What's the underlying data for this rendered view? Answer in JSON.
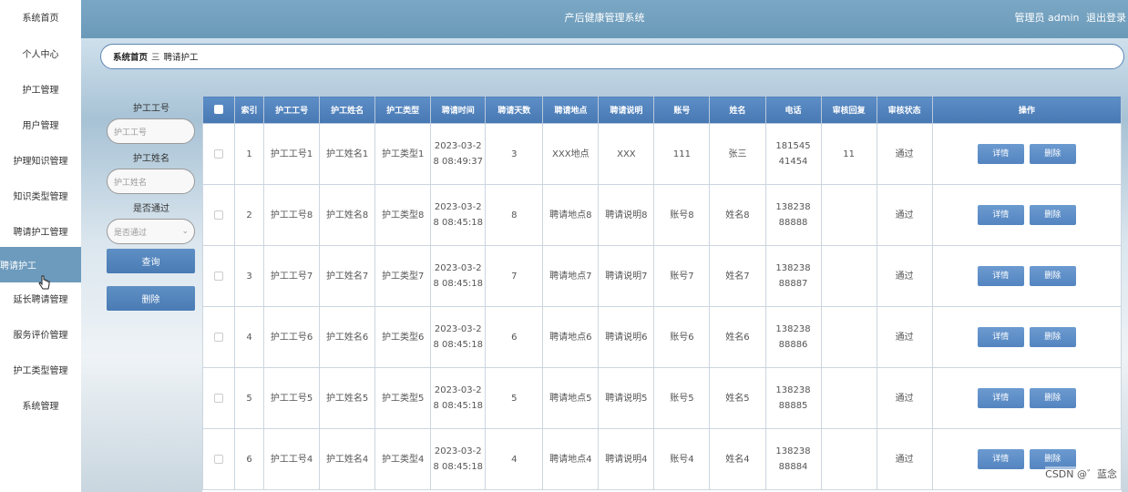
{
  "sidebar": {
    "items": [
      {
        "label": "系统首页"
      },
      {
        "label": "个人中心"
      },
      {
        "label": "护工管理"
      },
      {
        "label": "用户管理"
      },
      {
        "label": "护理知识管理"
      },
      {
        "label": "知识类型管理"
      },
      {
        "label": "聘请护工管理"
      },
      {
        "label": "聘请护工"
      },
      {
        "label": "延长聘请管理"
      },
      {
        "label": "服务评价管理"
      },
      {
        "label": "护工类型管理"
      },
      {
        "label": "系统管理"
      }
    ]
  },
  "header": {
    "title": "产后健康管理系统",
    "user": "管理员 admin",
    "logout": "退出登录"
  },
  "breadcrumb": {
    "home": "系统首页",
    "sep": "三",
    "current": "聘请护工"
  },
  "search": {
    "id_label": "护工工号",
    "id_placeholder": "护工工号",
    "name_label": "护工姓名",
    "name_placeholder": "护工姓名",
    "pass_label": "是否通过",
    "pass_placeholder": "是否通过",
    "query_button": "查询",
    "delete_button": "删除"
  },
  "table": {
    "columns": [
      "索引",
      "护工工号",
      "护工姓名",
      "护工类型",
      "聘请时间",
      "聘请天数",
      "聘请地点",
      "聘请说明",
      "账号",
      "姓名",
      "电话",
      "审核回复",
      "审核状态",
      "操作"
    ],
    "rows": [
      {
        "index": "1",
        "id": "护工工号1",
        "name": "护工姓名1",
        "type": "护工类型1",
        "time": "2023-03-28 08:49:37",
        "days": "3",
        "place": "XXX地点",
        "desc": "XXX",
        "account": "111",
        "uname": "张三",
        "phone": "18154541454",
        "reply": "11",
        "status": "通过"
      },
      {
        "index": "2",
        "id": "护工工号8",
        "name": "护工姓名8",
        "type": "护工类型8",
        "time": "2023-03-28 08:45:18",
        "days": "8",
        "place": "聘请地点8",
        "desc": "聘请说明8",
        "account": "账号8",
        "uname": "姓名8",
        "phone": "13823888888",
        "reply": "",
        "status": "通过"
      },
      {
        "index": "3",
        "id": "护工工号7",
        "name": "护工姓名7",
        "type": "护工类型7",
        "time": "2023-03-28 08:45:18",
        "days": "7",
        "place": "聘请地点7",
        "desc": "聘请说明7",
        "account": "账号7",
        "uname": "姓名7",
        "phone": "13823888887",
        "reply": "",
        "status": "通过"
      },
      {
        "index": "4",
        "id": "护工工号6",
        "name": "护工姓名6",
        "type": "护工类型6",
        "time": "2023-03-28 08:45:18",
        "days": "6",
        "place": "聘请地点6",
        "desc": "聘请说明6",
        "account": "账号6",
        "uname": "姓名6",
        "phone": "13823888886",
        "reply": "",
        "status": "通过"
      },
      {
        "index": "5",
        "id": "护工工号5",
        "name": "护工姓名5",
        "type": "护工类型5",
        "time": "2023-03-28 08:45:18",
        "days": "5",
        "place": "聘请地点5",
        "desc": "聘请说明5",
        "account": "账号5",
        "uname": "姓名5",
        "phone": "13823888885",
        "reply": "",
        "status": "通过"
      },
      {
        "index": "6",
        "id": "护工工号4",
        "name": "护工姓名4",
        "type": "护工类型4",
        "time": "2023-03-28 08:45:18",
        "days": "4",
        "place": "聘请地点4",
        "desc": "聘请说明4",
        "account": "账号4",
        "uname": "姓名4",
        "phone": "13823888884",
        "reply": "",
        "status": "通过"
      }
    ],
    "detail_button": "详情",
    "delete_button": "删除"
  },
  "watermark": "CSDN @゛蓝念",
  "colors": {
    "accent": "#4a7bb4",
    "header": "#6f9ebd",
    "active_nav": "#6d9bbd"
  }
}
